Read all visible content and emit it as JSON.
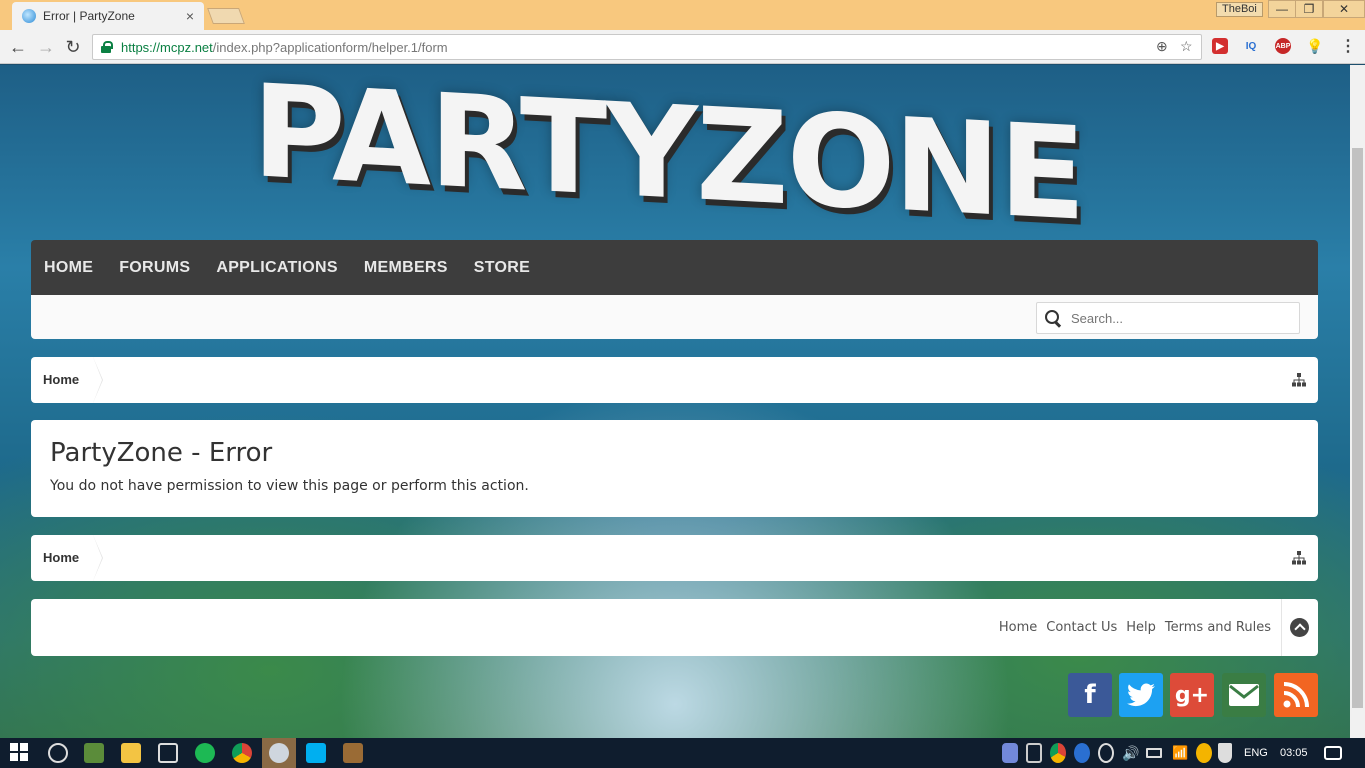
{
  "browser": {
    "tab_title": "Error | PartyZone",
    "tab_close": "×",
    "profile_name": "TheBoi",
    "url_host": "https://mcpz.net",
    "url_path": "/index.php?applicationform/helper.1/form",
    "extensions": [
      "IQ",
      "ABP"
    ]
  },
  "site": {
    "logo_text": "PARTYZONE",
    "nav": [
      "HOME",
      "FORUMS",
      "APPLICATIONS",
      "MEMBERS",
      "STORE"
    ],
    "search_placeholder": "Search..."
  },
  "breadcrumb": {
    "home": "Home"
  },
  "error": {
    "title": "PartyZone - Error",
    "message": "You do not have permission to view this page or perform this action."
  },
  "footer": {
    "links": [
      "Home",
      "Contact Us",
      "Help",
      "Terms and Rules"
    ]
  },
  "social": {
    "facebook": "f",
    "google": "g+",
    "colors": {
      "facebook": "#3b5998",
      "twitter": "#1da1f2",
      "google": "#dd4b39",
      "email": "#3a7d44",
      "rss": "#f26522"
    }
  },
  "taskbar": {
    "language": "ENG",
    "time": "03:05"
  }
}
